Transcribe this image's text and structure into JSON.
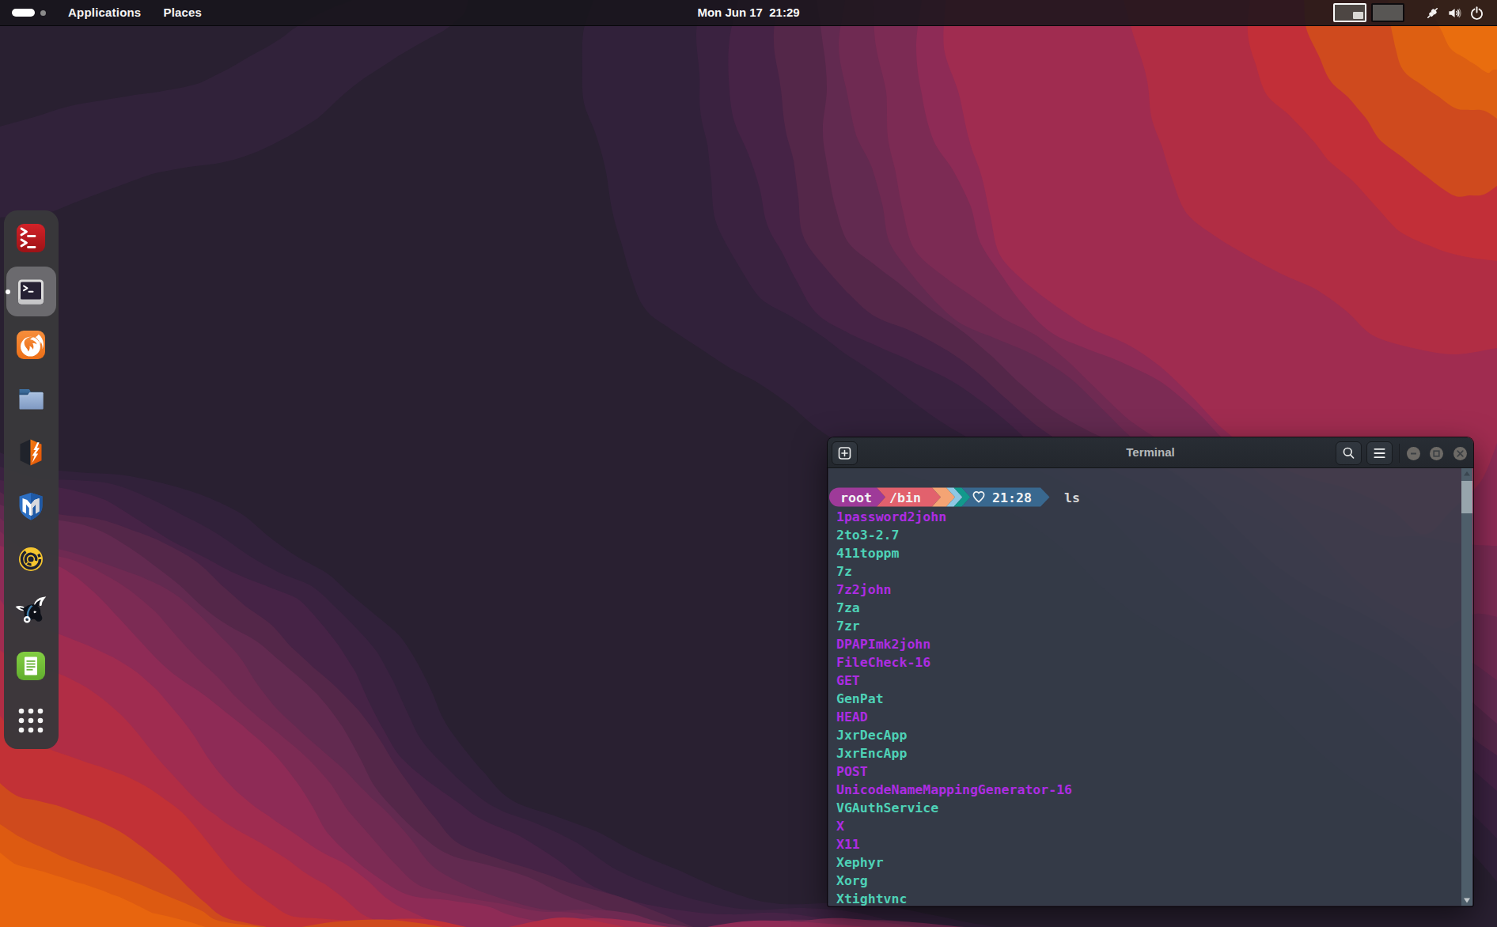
{
  "topbar": {
    "menus": [
      {
        "label": "Applications"
      },
      {
        "label": "Places"
      }
    ],
    "clock": "Mon Jun 17  21:29",
    "workspaces": {
      "count": 2,
      "active": 1
    },
    "status_icons": [
      "network-wired-icon",
      "volume-icon",
      "power-icon"
    ]
  },
  "dock": {
    "items": [
      {
        "name": "root-terminal",
        "icon": "red-terminal-icon",
        "running": false,
        "active": false
      },
      {
        "name": "terminal",
        "icon": "terminal-icon",
        "running": true,
        "active": true
      },
      {
        "name": "firefox",
        "icon": "firefox-icon",
        "running": false,
        "active": false
      },
      {
        "name": "files",
        "icon": "folder-icon",
        "running": false,
        "active": false
      },
      {
        "name": "burpsuite",
        "icon": "burpsuite-icon",
        "running": false,
        "active": false
      },
      {
        "name": "metasploit",
        "icon": "metasploit-icon",
        "running": false,
        "active": false
      },
      {
        "name": "cutter",
        "icon": "yellow-target-icon",
        "running": false,
        "active": false
      },
      {
        "name": "beef",
        "icon": "bull-icon",
        "running": false,
        "active": false
      },
      {
        "name": "notes",
        "icon": "notes-icon",
        "running": false,
        "active": false
      },
      {
        "name": "show-applications",
        "icon": "app-grid-icon",
        "running": false,
        "active": false
      }
    ]
  },
  "terminal": {
    "title": "Terminal",
    "titlebar_buttons": [
      "new-tab",
      "search",
      "menu",
      "minimize",
      "maximize",
      "close"
    ],
    "prompt": {
      "user": "root",
      "path": "/bin",
      "time": "21:28",
      "command": "ls"
    },
    "files": [
      {
        "name": "1password2john",
        "color": "purple"
      },
      {
        "name": "2to3-2.7",
        "color": "teal"
      },
      {
        "name": "411toppm",
        "color": "teal"
      },
      {
        "name": "7z",
        "color": "teal"
      },
      {
        "name": "7z2john",
        "color": "purple"
      },
      {
        "name": "7za",
        "color": "teal"
      },
      {
        "name": "7zr",
        "color": "teal"
      },
      {
        "name": "DPAPImk2john",
        "color": "purple"
      },
      {
        "name": "FileCheck-16",
        "color": "purple"
      },
      {
        "name": "GET",
        "color": "purple"
      },
      {
        "name": "GenPat",
        "color": "teal"
      },
      {
        "name": "HEAD",
        "color": "purple"
      },
      {
        "name": "JxrDecApp",
        "color": "teal"
      },
      {
        "name": "JxrEncApp",
        "color": "teal"
      },
      {
        "name": "POST",
        "color": "purple"
      },
      {
        "name": "UnicodeNameMappingGenerator-16",
        "color": "purple"
      },
      {
        "name": "VGAuthService",
        "color": "teal"
      },
      {
        "name": "X",
        "color": "purple"
      },
      {
        "name": "X11",
        "color": "purple"
      },
      {
        "name": "Xephyr",
        "color": "teal"
      },
      {
        "name": "Xorg",
        "color": "teal"
      },
      {
        "name": "Xtightvnc",
        "color": "teal"
      }
    ],
    "colors": {
      "file_purple": "#ad2ce2",
      "file_teal": "#4ed1b6",
      "prompt_user_bg": "#9e3a99",
      "prompt_path_bg": "#e2616d",
      "prompt_chevron_orange": "#f4a474",
      "prompt_chevron_blue": "#8fc7e3",
      "prompt_chevron_teal": "#12998c",
      "prompt_time_bg": "#39688f",
      "background": "rgba(44,50,62,0.84)"
    }
  },
  "wallpaper": {
    "style": "layered topographic waves",
    "palette": [
      "#292031",
      "#31213a",
      "#3a2240",
      "#462346",
      "#542749",
      "#622a50",
      "#6f2a52",
      "#7c2b54",
      "#8e2b56",
      "#a02c50",
      "#b12d45",
      "#c23136",
      "#cf4a1d",
      "#dd5a11",
      "#e8650e",
      "#e96d0e"
    ]
  }
}
